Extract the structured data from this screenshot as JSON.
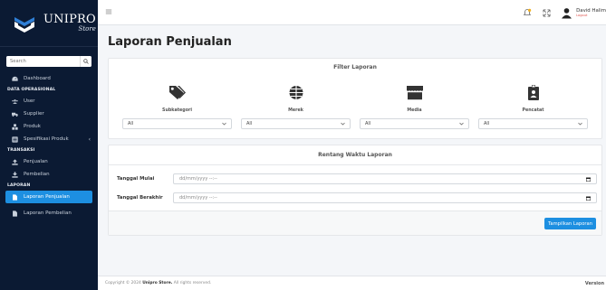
{
  "brand": {
    "name": "UNIPRO",
    "sub": "Store"
  },
  "search": {
    "placeholder": "Search"
  },
  "sidebar": {
    "dashboard": "Dashboard",
    "section_master": "DATA OPERASIONAL",
    "user": "User",
    "supplier": "Supplier",
    "produk": "Produk",
    "spesifikasi": "Spesifikasi Produk",
    "section_transaksi": "TRANSAKSI",
    "penjualan": "Penjualan",
    "pembelian": "Pembelian",
    "section_laporan": "LAPORAN",
    "laporan_penjualan": "Laporan Penjualan",
    "laporan_pembelian": "Laporan Pembelian"
  },
  "topbar": {
    "user_name": "David Halim",
    "user_status": "Logout"
  },
  "page": {
    "title": "Laporan Penjualan"
  },
  "filter_card": {
    "title": "Filter Laporan",
    "filters": [
      {
        "label": "Subkategori",
        "value": "All"
      },
      {
        "label": "Merek",
        "value": "All"
      },
      {
        "label": "Media",
        "value": "All"
      },
      {
        "label": "Pencatat",
        "value": "All"
      }
    ]
  },
  "date_card": {
    "title": "Rentang Waktu Laporan",
    "start_label": "Tanggal Mulai",
    "start_placeholder": "dd/mm/yyyy --:--",
    "end_label": "Tanggal Berakhir",
    "end_placeholder": "dd/mm/yyyy --:--",
    "button": "Tampilkan Laporan"
  },
  "footer": {
    "prefix": "Copyright © 2024",
    "brand": "Unipro Store.",
    "suffix": "All rights reserved.",
    "version": "Version"
  },
  "colors": {
    "sidebar": "#0b1a33",
    "accent": "#1d8fe1",
    "logout": "#e0554f"
  }
}
